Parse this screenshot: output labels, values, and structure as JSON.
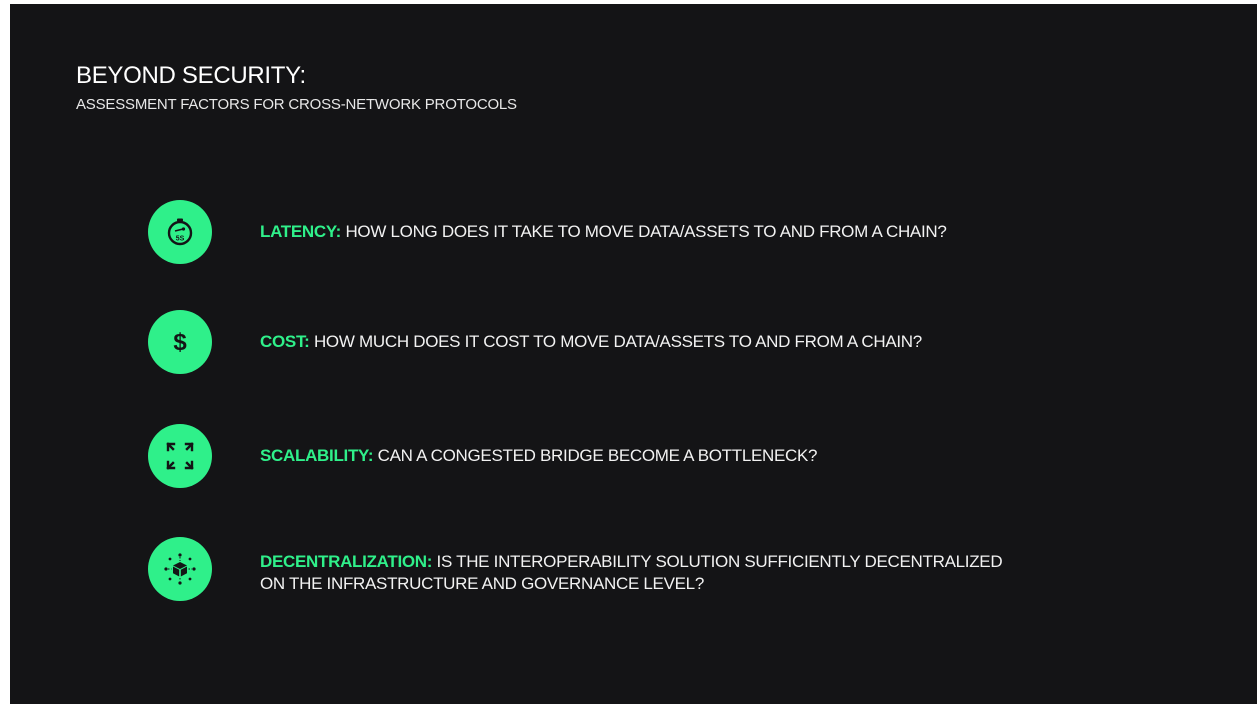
{
  "heading": {
    "title": "BEYOND SECURITY:",
    "subtitle": "ASSESSMENT FACTORS FOR CROSS-NETWORK PROTOCOLS"
  },
  "factors": [
    {
      "label": "LATENCY:",
      "text": " HOW LONG DOES IT TAKE TO MOVE DATA/ASSETS TO AND FROM A CHAIN?",
      "icon": "stopwatch-icon",
      "icon_text": "5S"
    },
    {
      "label": "COST:",
      "text": " HOW MUCH DOES IT COST TO MOVE DATA/ASSETS TO AND FROM A CHAIN?",
      "icon": "dollar-icon",
      "icon_text": "$"
    },
    {
      "label": "SCALABILITY:",
      "text": " CAN A CONGESTED BRIDGE BECOME A BOTTLENECK?",
      "icon": "expand-arrows-icon"
    },
    {
      "label": "DECENTRALIZATION:",
      "text": " IS THE INTEROPERABILITY SOLUTION SUFFICIENTLY DECENTRALIZED",
      "text_line2": "ON THE INFRASTRUCTURE AND GOVERNANCE LEVEL?",
      "icon": "network-cube-icon"
    }
  ],
  "colors": {
    "background": "#141416",
    "accent": "#2ff08a",
    "text": "#f2f2f2"
  }
}
